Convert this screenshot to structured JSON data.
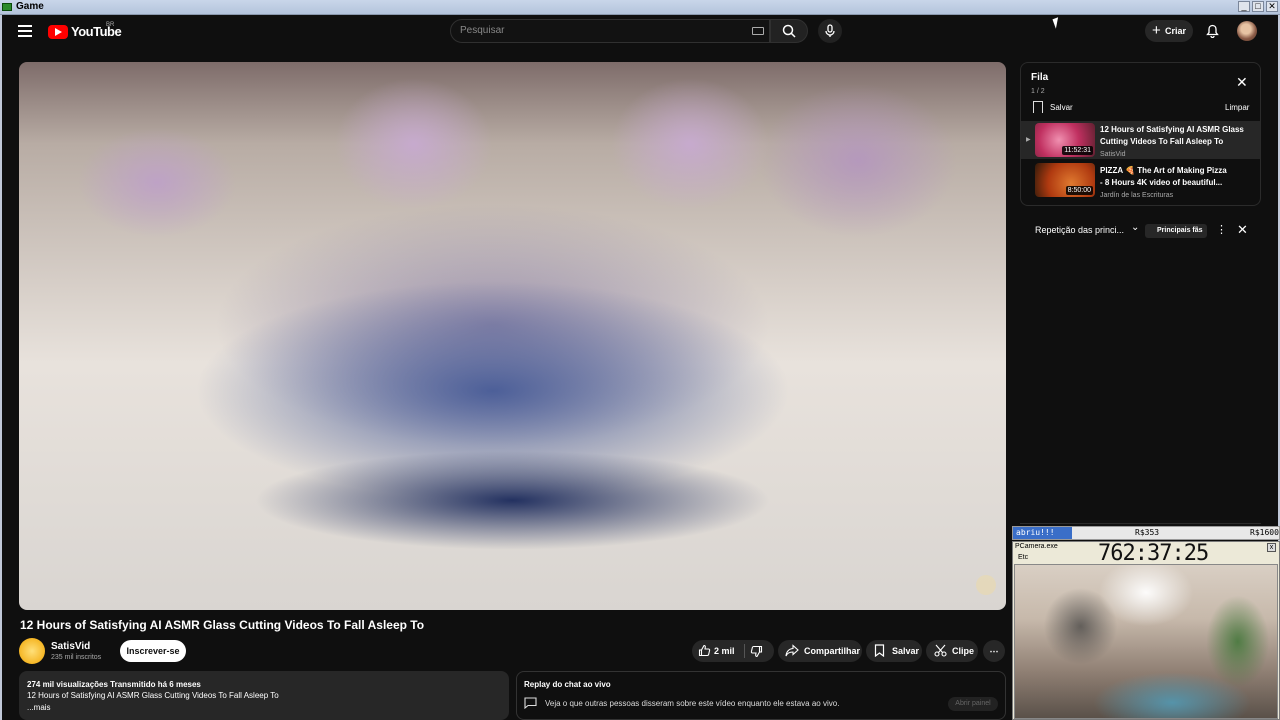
{
  "window": {
    "title": "Game",
    "minimize": "_",
    "maximize": "□",
    "close": "✕"
  },
  "header": {
    "logo_text": "YouTube",
    "country_code": "BR",
    "search_placeholder": "Pesquisar",
    "create_label": "Criar",
    "icons": [
      "menu-icon",
      "search-icon",
      "mic-icon",
      "keyboard-icon",
      "bell-icon",
      "plus-icon"
    ]
  },
  "video": {
    "title": "12 Hours of Satisfying AI ASMR Glass Cutting Videos To Fall Asleep To",
    "channel": "SatisVid",
    "subscribers": "235 mil inscritos",
    "subscribe_label": "Inscrever-se",
    "likes": "2 mil",
    "share_label": "Compartilhar",
    "save_label": "Salvar",
    "clip_label": "Clipe",
    "more_label": "⋯"
  },
  "description": {
    "stats": "274 mil visualizações  Transmitido há 6 meses",
    "text": "12 Hours of Satisfying AI ASMR Glass Cutting Videos To Fall Asleep To",
    "more": "...mais"
  },
  "chat_replay": {
    "title": "Replay do chat ao vivo",
    "text": "Veja o que outras pessoas disseram sobre este vídeo enquanto ele estava ao vivo.",
    "open_label": "Abrir painel"
  },
  "queue": {
    "title": "Fila",
    "count": "1 / 2",
    "save_label": "Salvar",
    "clear_label": "Limpar",
    "close": "✕",
    "items": [
      {
        "title_line1": "12 Hours of Satisfying AI ASMR Glass",
        "title_line2": "Cutting Videos To Fall Asleep To",
        "channel": "SatisVid",
        "duration": "11:52:31",
        "playing": true
      },
      {
        "title_line1": "PIZZA 🍕 The Art of Making Pizza",
        "title_line2": "- 8 Hours 4K video of beautiful...",
        "channel": "Jardín de las Escrituras",
        "duration": "8:50:00",
        "playing": false
      }
    ]
  },
  "live_chat": {
    "mode_label": "Repetição das princi...",
    "badge_label": "Principais fãs",
    "more": "⋮",
    "close": "✕"
  },
  "overlay": {
    "donation_label": "abriu!!!",
    "donation_current": "R$353",
    "donation_goal": "R$1600",
    "donation_progress": 0.22,
    "camera_title": "PCamera.exe",
    "camera_menu": "Etc",
    "timer": "762:37:25",
    "close": "x"
  }
}
